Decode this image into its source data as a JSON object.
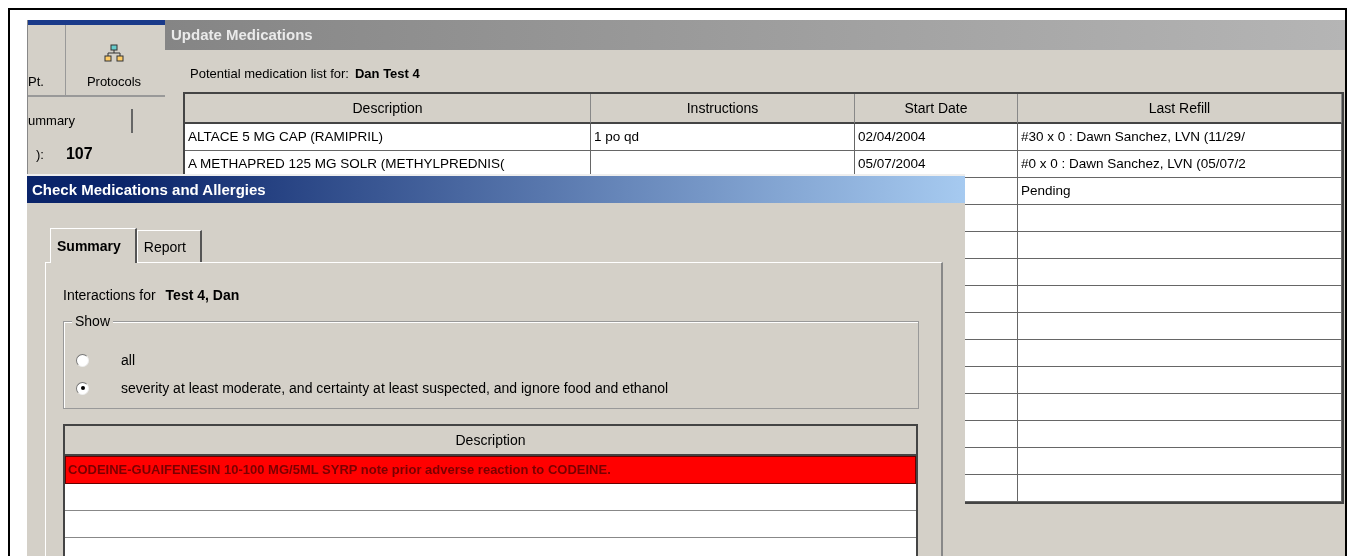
{
  "background_app": {
    "toolbar": [
      {
        "label": "Pt.",
        "kind": "plain"
      },
      {
        "label": "Protocols",
        "kind": "hierarchy"
      }
    ],
    "tab": "ummary",
    "field_label": "):",
    "field_value": "107"
  },
  "update_window": {
    "title": "Update Medications",
    "list_label": "Potential medication list for:",
    "patient": "Dan Test 4",
    "table": {
      "columns": [
        "Description",
        "Instructions",
        "Start Date",
        "Last Refill"
      ],
      "rows": [
        {
          "description": "ALTACE 5 MG CAP (RAMIPRIL)",
          "instructions": "1 po qd",
          "start_date": "02/04/2004",
          "last_refill": "#30 x 0 : Dawn Sanchez, LVN (11/29/"
        },
        {
          "description": "A METHAPRED 125 MG SOLR (METHYLPREDNIS(",
          "start_date": "05/07/2004",
          "last_refill": "#0 x 0 : Dawn Sanchez, LVN (05/07/2"
        },
        {
          "last_refill": "Pending"
        }
      ]
    }
  },
  "dialog": {
    "title": "Check Medications and Allergies",
    "tabs": [
      {
        "label": "Summary",
        "selected": true
      },
      {
        "label": "Report",
        "selected": false
      }
    ],
    "interactions_label": "Interactions for",
    "patient": "Test 4, Dan",
    "show_group": {
      "legend": "Show",
      "options": [
        {
          "label": "all",
          "selected": false
        },
        {
          "label": "severity at least moderate, and certainty at least suspected, and ignore food and ethanol",
          "selected": true
        }
      ]
    },
    "table": {
      "columns": [
        "Description"
      ],
      "rows": [
        {
          "text": "CODEINE-GUAIFENESIN 10-100 MG/5ML SYRP note prior adverse reaction to CODEINE.",
          "flagged": true
        }
      ]
    }
  }
}
